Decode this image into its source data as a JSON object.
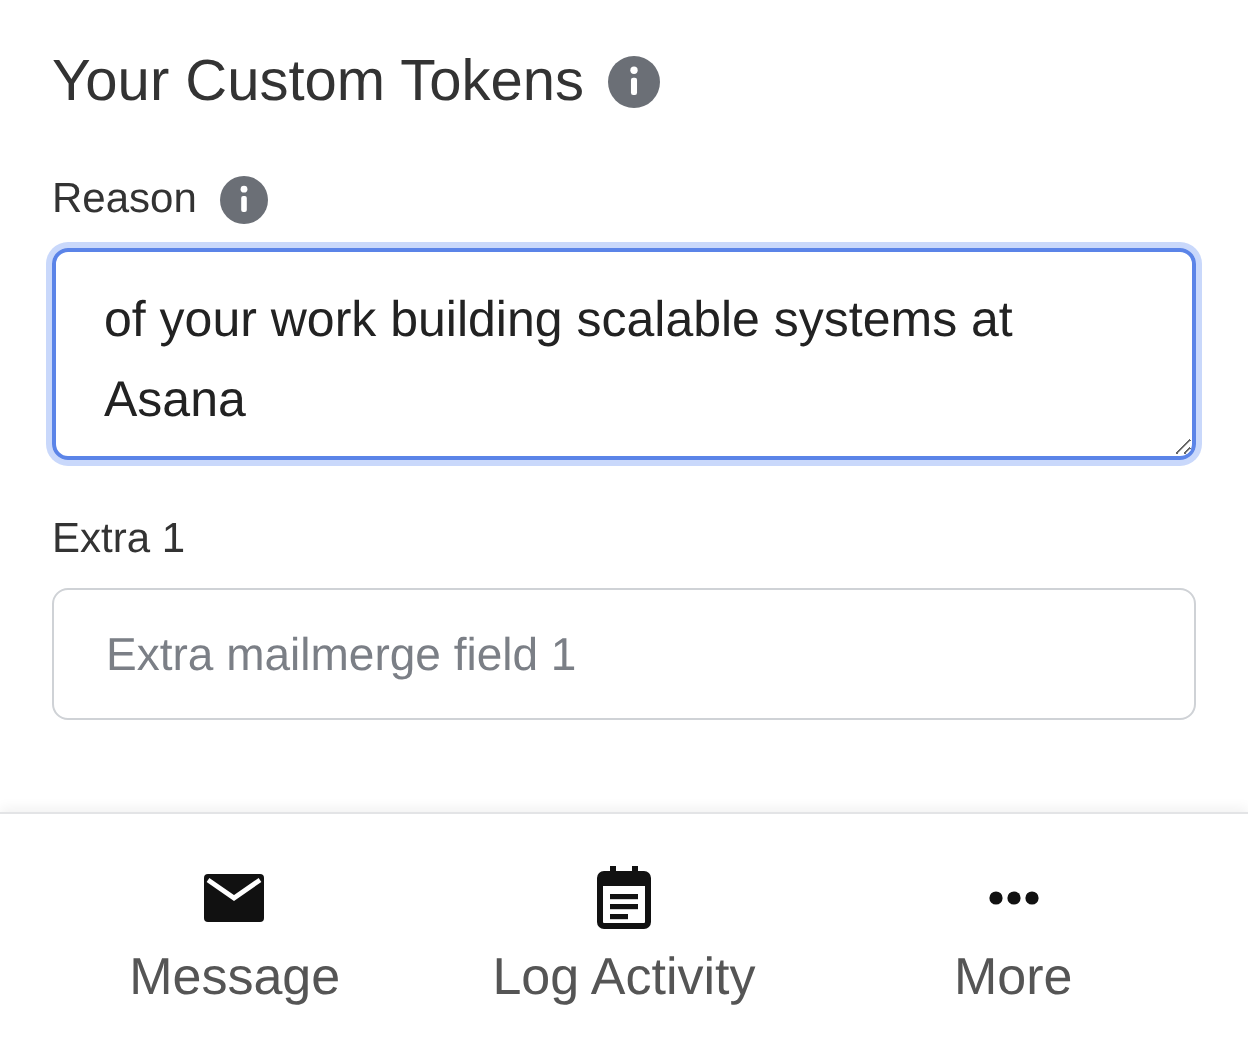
{
  "section": {
    "title": "Your Custom Tokens"
  },
  "fields": [
    {
      "kind": "textarea",
      "label": "Reason",
      "info": true,
      "focused": true,
      "value": "of your work building scalable systems at Asana"
    },
    {
      "kind": "input",
      "label": "Extra 1",
      "info": false,
      "focused": false,
      "placeholder": "Extra mailmerge field 1"
    }
  ],
  "bottom_nav": [
    {
      "kind": "mail",
      "label": "Message"
    },
    {
      "kind": "calendar",
      "label": "Log Activity"
    },
    {
      "kind": "more",
      "label": "More"
    }
  ]
}
